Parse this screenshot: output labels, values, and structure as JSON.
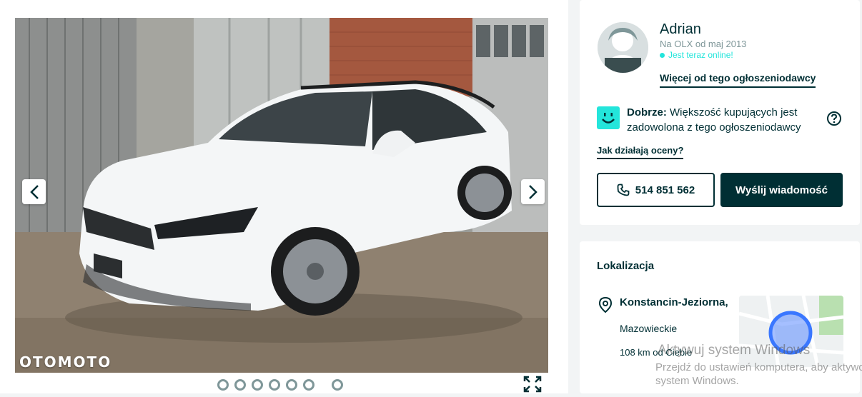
{
  "gallery": {
    "watermark": "OTOMOTO",
    "dot_count_group1": 6,
    "dot_count_group2": 1,
    "prev_icon": "chevron-left-icon",
    "next_icon": "chevron-right-icon",
    "fullscreen_icon": "expand-icon"
  },
  "seller": {
    "name": "Adrian",
    "since": "Na OLX od maj 2013",
    "online": "Jest teraz online!",
    "more_link": "Więcej od tego ogłoszeniodawcy",
    "rating_label": "Dobrze:",
    "rating_text": " Większość kupujących jest zadowolona z tego ogłoszeniodawcy",
    "how_link": "Jak działają oceny?",
    "phone": "514 851 562",
    "message_button": "Wyślij wiadomość"
  },
  "location": {
    "title": "Lokalizacja",
    "city": "Konstancin-Jeziorna,",
    "region": "Mazowieckie",
    "distance": "108 km od Ciebie"
  },
  "windows_activation": {
    "title": "Aktywuj system Windows",
    "line1": "Przejdź do ustawień komputera, aby aktywować",
    "line2": "system Windows."
  },
  "colors": {
    "brand_dark": "#002f34",
    "accent_teal": "#23e5db",
    "muted": "#7f9799",
    "map_circle": "#3a77ff"
  }
}
